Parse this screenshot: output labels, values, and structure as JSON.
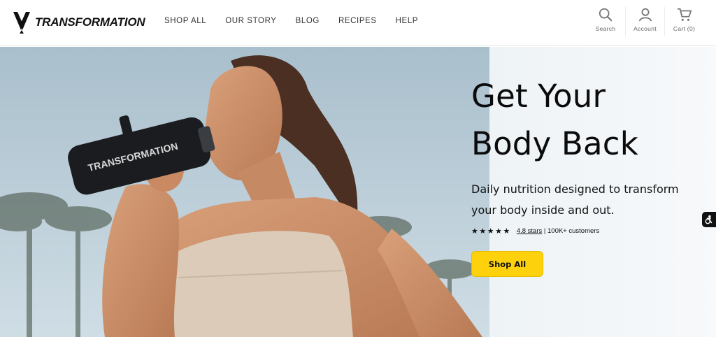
{
  "brand": {
    "name": "TRANSFORMATION",
    "bottle_text": "TRANSFORMATION"
  },
  "nav": {
    "items": [
      {
        "label": "SHOP ALL"
      },
      {
        "label": "OUR STORY"
      },
      {
        "label": "BLOG"
      },
      {
        "label": "RECIPES"
      },
      {
        "label": "HELP"
      }
    ]
  },
  "utils": {
    "search": {
      "label": "Search",
      "icon": "search-icon"
    },
    "account": {
      "label": "Account",
      "icon": "user-icon"
    },
    "cart": {
      "label": "Cart (0)",
      "icon": "cart-icon"
    }
  },
  "hero": {
    "title_line1": "Get Your",
    "title_line2": "Body Back",
    "subtitle": "Daily nutrition designed to transform your body inside and out.",
    "stars": "★★★★★",
    "rating_link": "4.8 stars",
    "rating_rest": " | 100K+ customers",
    "cta": "Shop All"
  },
  "colors": {
    "accent": "#fdd10b",
    "text": "#111111",
    "sky": "#c7d7e0"
  },
  "accessibility": {
    "icon": "accessibility-icon"
  }
}
